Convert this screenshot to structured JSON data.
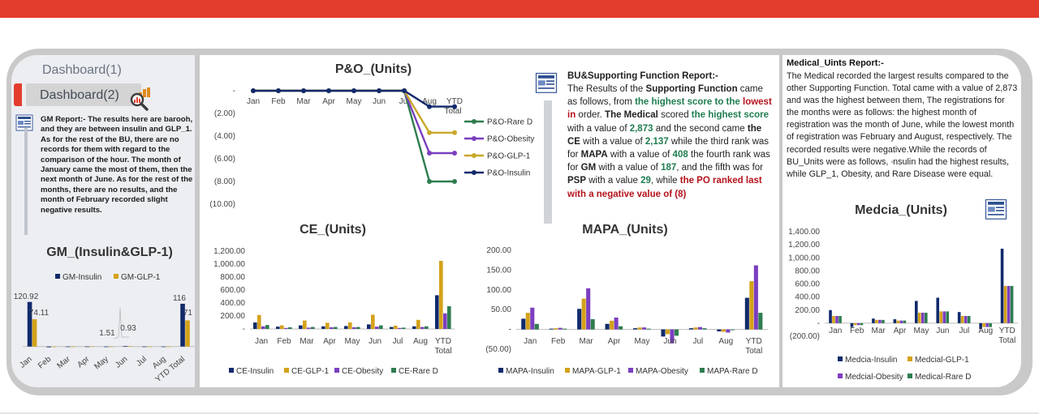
{
  "nav": {
    "item1": "Dashboard(1)",
    "item2": "Dashboard(2)"
  },
  "gm_report": {
    "heading": "GM Report:-",
    "text": " The results here are barooh, and they are between insulin and GLP_1. As for the rest of the BU, there are no records for them with regard to the comparison of the hour. The month of January came the most of them, then the next month of June. As for the rest of the months, there are no results, and the month of February recorded slight negative results."
  },
  "bu_report": {
    "title": "BU&Supporting Function Report:-",
    "p1": "The Results of the ",
    "p2": "Supporting Function",
    "p3": " came as follows, from ",
    "p4": "the highest score to the",
    "p5": "lowest in",
    "p6": " order. ",
    "p7": "The Medical",
    "p8": " scored ",
    "p9": "the highest score",
    "p10": " with a value of ",
    "p11": "2,873",
    "p12": " and the second came ",
    "p13": "the CE",
    "p14": " with a value of ",
    "p15": "2,137",
    "p16": " while the third rank was for ",
    "p17": "MAPA",
    "p18": " with a value of ",
    "p19": "408",
    "p20": " the fourth rank was for ",
    "p21": "GM",
    "p22": " with a value of ",
    "p23": "187",
    "p24": ", and the fifth was for ",
    "p25": "PSP",
    "p26": " with a value ",
    "p27": "29",
    "p28": ", while ",
    "p29": "the PO ranked last with a negative value of (8)"
  },
  "medical_report": {
    "title": "Medical_Uints Report:-",
    "text": "The Medical recorded the largest results compared to the other Supporting Function. Total came with a value of 2,873 and was the highest between them, The registrations for the months were as follows: the highest month of registration was the month of June, while the lowest month of registration was February and August, respectively. The recorded results were negative.While the records of BU_Units were as follows, ۥnsulin had the highest results, while GLP_1, Obesity, and Rare Disease were equal."
  },
  "colors": {
    "navy": "#102a6b",
    "gold": "#d4a21a",
    "purple": "#7b3fbf",
    "green": "#2e7d4f",
    "olive": "#a69a1f",
    "red": "#e33d2e"
  },
  "chart_data": [
    {
      "id": "po",
      "type": "line",
      "title": "P&O_(Units)",
      "categories": [
        "Jan",
        "Feb",
        "Mar",
        "Apr",
        "May",
        "Jun",
        "Jul",
        "Aug",
        "YTD Total"
      ],
      "ylim": [
        -10,
        0
      ],
      "yticks": [
        "-",
        "(2.00)",
        "(4.00)",
        "(6.00)",
        "(8.00)",
        "(10.00)"
      ],
      "series": [
        {
          "name": "P&O-Rare D",
          "color": "#2e7d4f",
          "values": [
            0,
            0,
            0,
            0,
            0,
            0,
            0,
            -8,
            -8
          ]
        },
        {
          "name": "P&O-Obesity",
          "color": "#7b3fbf",
          "values": [
            0,
            0,
            0,
            0,
            0,
            0,
            0,
            -5.5,
            -5.5
          ]
        },
        {
          "name": "P&O-GLP-1",
          "color": "#c9a82a",
          "values": [
            0,
            0,
            0,
            0,
            0,
            0,
            0,
            -3.7,
            -3.7
          ]
        },
        {
          "name": "P&O-Insulin",
          "color": "#102a6b",
          "values": [
            0,
            0,
            0,
            0,
            0,
            0,
            0,
            -1.4,
            -1.4
          ]
        }
      ]
    },
    {
      "id": "gm",
      "type": "bar",
      "title": "GM_(Insulin&GLP-1)",
      "categories": [
        "Jan",
        "Feb",
        "Mar",
        "Apr",
        "May",
        "Jun",
        "Jul",
        "Aug",
        "YTD Total"
      ],
      "ylim": [
        -5,
        140
      ],
      "labels": [
        "120.92",
        "74.11",
        "1.51",
        "0.93",
        "116",
        "71"
      ],
      "series": [
        {
          "name": "GM-Insulin",
          "color": "#102a6b",
          "values": [
            120.92,
            -2,
            0,
            0,
            0,
            1.51,
            0,
            0,
            116
          ]
        },
        {
          "name": "GM-GLP-1",
          "color": "#d4a21a",
          "values": [
            74.11,
            -1,
            0,
            0,
            0,
            0.93,
            0,
            0,
            71
          ]
        }
      ]
    },
    {
      "id": "ce",
      "type": "bar",
      "title": "CE_(Units)",
      "categories": [
        "Jan",
        "Feb",
        "Mar",
        "Apr",
        "May",
        "Jun",
        "Jul",
        "Aug",
        "YTD Total"
      ],
      "ylim": [
        0,
        1200
      ],
      "yticks": [
        "1,200.00",
        "1,000.00",
        "800.00",
        "600.00",
        "400.00",
        "200.00",
        "-"
      ],
      "series": [
        {
          "name": "CE-Insulin",
          "color": "#102a6b",
          "values": [
            100,
            35,
            55,
            40,
            45,
            70,
            30,
            40,
            520
          ]
        },
        {
          "name": "CE-GLP-1",
          "color": "#d4a21a",
          "values": [
            215,
            55,
            130,
            95,
            100,
            220,
            50,
            140,
            1050
          ]
        },
        {
          "name": "CE-Obesity",
          "color": "#7b3fbf",
          "values": [
            40,
            15,
            20,
            25,
            25,
            35,
            15,
            30,
            240
          ]
        },
        {
          "name": "CE-Rare D",
          "color": "#2e7d4f",
          "values": [
            60,
            25,
            30,
            30,
            30,
            55,
            20,
            40,
            350
          ]
        }
      ]
    },
    {
      "id": "mapa",
      "type": "bar",
      "title": "MAPA_(Units)",
      "categories": [
        "Jan",
        "Feb",
        "Mar",
        "Apr",
        "May",
        "Jun",
        "Jul",
        "Aug",
        "YTD Total"
      ],
      "ylim": [
        -50,
        200
      ],
      "yticks": [
        "200.00",
        "150.00",
        "100.00",
        "50.00",
        "-",
        "(50.00)"
      ],
      "series": [
        {
          "name": "MAPA-Insulin",
          "color": "#102a6b",
          "values": [
            27,
            2,
            52,
            14,
            3,
            -18,
            3,
            -5,
            80
          ]
        },
        {
          "name": "MAPA-GLP-1",
          "color": "#d4a21a",
          "values": [
            42,
            3,
            78,
            22,
            5,
            -12,
            5,
            -6,
            122
          ]
        },
        {
          "name": "MAPA-Obesity",
          "color": "#7b3fbf",
          "values": [
            55,
            4,
            104,
            30,
            5,
            -35,
            6,
            -8,
            162
          ]
        },
        {
          "name": "MAPA-Rare D",
          "color": "#2e7d4f",
          "values": [
            14,
            2,
            26,
            8,
            2,
            -16,
            3,
            -2,
            42
          ]
        }
      ]
    },
    {
      "id": "medical",
      "type": "bar",
      "title": "Medcia_(Units)",
      "categories": [
        "Jan",
        "Feb",
        "Mar",
        "Apr",
        "May",
        "Jun",
        "Jul",
        "Aug",
        "YTD Total"
      ],
      "ylim": [
        -200,
        1400
      ],
      "yticks": [
        "1,400.00",
        "1,200.00",
        "1,000.00",
        "800.00",
        "600.00",
        "400.00",
        "200.00",
        "-",
        "(200.00)"
      ],
      "series": [
        {
          "name": "Medcia-Insulin",
          "color": "#102a6b",
          "values": [
            200,
            -60,
            70,
            60,
            340,
            390,
            170,
            -90,
            1140
          ]
        },
        {
          "name": "Medcial-GLP-1",
          "color": "#d4a21a",
          "values": [
            110,
            -30,
            50,
            40,
            160,
            180,
            110,
            -60,
            570
          ]
        },
        {
          "name": "Medcial-Obesity",
          "color": "#7b3fbf",
          "values": [
            110,
            -30,
            50,
            40,
            160,
            180,
            110,
            -60,
            570
          ]
        },
        {
          "name": "Medical-Rare D",
          "color": "#2e7d4f",
          "values": [
            110,
            -30,
            50,
            40,
            160,
            180,
            110,
            -60,
            570
          ]
        }
      ]
    }
  ]
}
